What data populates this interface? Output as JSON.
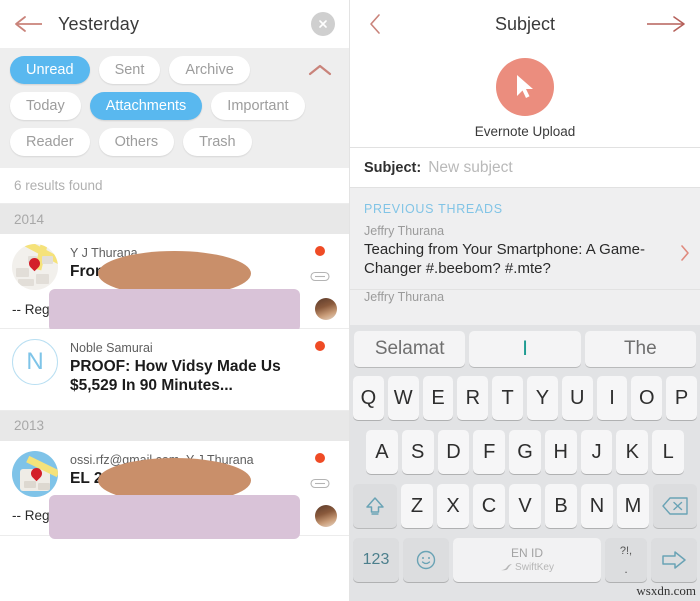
{
  "left": {
    "header": {
      "title": "Yesterday",
      "back_icon": "arrow-left-icon",
      "close_icon": "close-circle-icon"
    },
    "filters": {
      "collapse_icon": "chevron-up-icon",
      "rows": [
        [
          {
            "label": "Unread",
            "active": true
          },
          {
            "label": "Sent",
            "active": false
          },
          {
            "label": "Archive",
            "active": false
          }
        ],
        [
          {
            "label": "Today",
            "active": false
          },
          {
            "label": "Attachments",
            "active": true
          },
          {
            "label": "Important",
            "active": false
          }
        ],
        [
          {
            "label": "Reader",
            "active": false
          },
          {
            "label": "Others",
            "active": false
          },
          {
            "label": "Trash",
            "active": false
          }
        ]
      ]
    },
    "results_text": "6 results found",
    "groups": [
      {
        "year": "2014",
        "items": [
          {
            "sender": "Y J Thurana",
            "subject": "From Novicto",
            "preview": "-- Regards, YJ Thurana http://...",
            "unread": true,
            "has_attachment": true,
            "thumb": "map-thumbnail",
            "avatar": "photo-avatar"
          },
          {
            "sender": "Noble Samurai",
            "subject": "PROOF: How Vidsy Made Us $5,529 In 90 Minutes...",
            "preview": "",
            "unread": true,
            "has_attachment": false,
            "thumb": "letter-avatar",
            "thumb_letter": "N",
            "avatar": ""
          }
        ]
      },
      {
        "year": "2013",
        "items": [
          {
            "sender": "ossi.rfz@gmail.com, Y J Thurana",
            "subject": "EL 2",
            "preview": "-- Regards, YJ Thurana http://...",
            "unread": true,
            "has_attachment": true,
            "thumb": "map-thumbnail-blue",
            "avatar": "photo-avatar"
          }
        ]
      }
    ]
  },
  "right": {
    "header": {
      "title": "Subject",
      "back_icon": "chevron-left-icon",
      "send_icon": "arrow-right-icon"
    },
    "attachment": {
      "label": "Evernote Upload",
      "icon": "cursor-arrow-icon",
      "circle_color": "#eb8d7e"
    },
    "subject_field": {
      "label": "Subject:",
      "placeholder": "New subject",
      "value": ""
    },
    "previous_threads_header": "PREVIOUS THREADS",
    "threads": [
      {
        "sender": "Jeffry Thurana",
        "subject": "Teaching from Your Smartphone: A Game-Changer #.beebom? #.mte?",
        "chevron_icon": "chevron-right-icon"
      },
      {
        "sender": "Jeffry Thurana",
        "subject": "",
        "chevron_icon": ""
      }
    ]
  },
  "keyboard": {
    "suggestions": [
      {
        "label": "Selamat",
        "is_cursor": false
      },
      {
        "label": "I",
        "is_cursor": true
      },
      {
        "label": "The",
        "is_cursor": false
      }
    ],
    "row1": [
      "Q",
      "W",
      "E",
      "R",
      "T",
      "Y",
      "U",
      "I",
      "O",
      "P"
    ],
    "row2": [
      "A",
      "S",
      "D",
      "F",
      "G",
      "H",
      "J",
      "K",
      "L"
    ],
    "row3": [
      "Z",
      "X",
      "C",
      "V",
      "B",
      "N",
      "M"
    ],
    "shift_icon": "shift-up-icon",
    "backspace_icon": "backspace-icon",
    "numbers_key": "123",
    "emoji_icon": "smiley-icon",
    "space_language": "EN ID",
    "space_brand": "SwiftKey",
    "punct_top": "?!,",
    "punct_bottom": ".",
    "enter_icon": "arrow-right-enter-icon"
  },
  "watermark": "wsxdn.com",
  "colors": {
    "accent_blue": "#59b8ef",
    "unread_dot": "#ef4b25",
    "salmon": "#eb8d7e",
    "thread_header": "#81c4e6"
  }
}
